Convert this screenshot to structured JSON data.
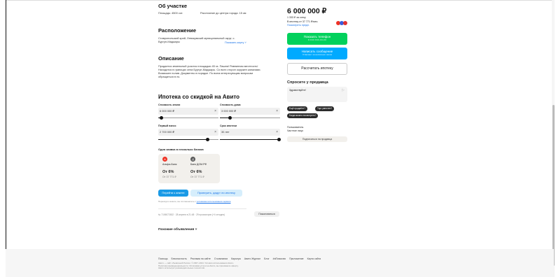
{
  "about": {
    "title": "Об участке",
    "area": "Площадь: 4500 сот.",
    "distance": "Расстояние до центра города: 15 км"
  },
  "location": {
    "title": "Расположение",
    "address_l1": "Ставропольский край, Левокумский муниципальный округ, с.",
    "address_l2": "Бургун-Маджары",
    "show_map": "Показать карту ˅"
  },
  "description": {
    "title": "Описание",
    "lines": [
      "Продается земельный участок площадью 45 га. Пашня! Равнинная местность!",
      "Находится в границах села Бургун-Маджары. Со всех сторон окружен каналами.",
      "Возможен полив. Документы в порядке. По всем интересующим вопросам",
      "обращаться в лс."
    ]
  },
  "mortgage": {
    "title": "Ипотека со скидкой на Авито",
    "land_label": "Стоимость земли",
    "land_value": "6 000 000 ₽",
    "house_label": "Стоимость дома",
    "house_value": "3 000 000 ₽",
    "down_label": "Первый взнос",
    "down_value": "2 700 000 ₽",
    "term_label": "Срок ипотеки",
    "term_value": "30 лет",
    "clear_icon": "×",
    "banks_title": "Одна заявка в несколько банков",
    "banks": [
      {
        "name": "Альфа-Банк",
        "rate": "От 6%",
        "payment": "От 37 771 ₽",
        "color": "#ef3124",
        "glyph": "А"
      },
      {
        "name": "Банк ДОМ.РФ",
        "rate": "От 6%",
        "payment": "От 37 771 ₽",
        "color": "#5a5a5a",
        "glyph": "Д"
      }
    ],
    "go_button": "Перейти к анкете",
    "check_button": "Проверить, дадут ли ипотеку",
    "consent": "Переходя к анкете, вы соглашаетесь с ",
    "consent_link": "условиями использования сервиса"
  },
  "meta": {
    "ad_info": "№ 7106072632 · 28 апреля в 21:48 · 29 просмотров (+4 сегодня)",
    "complain": "Пожаловаться"
  },
  "similar": "Похожие объявления ˅",
  "sidebar": {
    "price": "6 000 000 ₽",
    "per_unit": "1 333 ₽ за сотку",
    "mortgage_note": "В ипотеку от 37 771 ₽/мес.",
    "mortgage_link": "Посмотреть предл.",
    "show_phone": "Показать телефон",
    "phone_masked": "8 XXX XXX-XX-XX",
    "write_message": "Написать сообщение",
    "write_sub": "Отвечает за несколько часов",
    "calc_mortgage": "Рассчитать ипотеку",
    "ask_title": "Спросите у продавца",
    "ask_placeholder": "Здравствуйте!",
    "chips": [
      "Ещё продаёте?",
      "Торг уместен?",
      "Когда можно посмотреть?"
    ],
    "seller_name": "Пользователь",
    "seller_type": "Частное лицо",
    "subscribe": "Подписаться на продавца"
  },
  "footer": {
    "links": [
      "Помощь",
      "Безопасность",
      "Реклама на сайте",
      "О компании",
      "Карьера",
      "Авито Журнал",
      "Блог",
      "#яПомогаю",
      "Приложение",
      "Карта сайта"
    ],
    "legal_l1": "Авито — сайт объявлений России. © 2007–2024. Условия использования Авито.",
    "legal_l2": "Политика конфиденциальности. Оплачивая услуги на Авито, вы принимаете оферту.",
    "legal_l3": "Авито использует рекомендательные технологии."
  },
  "colors": {
    "green": "#02d15c",
    "blue": "#00aaff",
    "go": "#1a9ae6",
    "check": "#d6eefc",
    "chip": "#2b2b2b"
  }
}
